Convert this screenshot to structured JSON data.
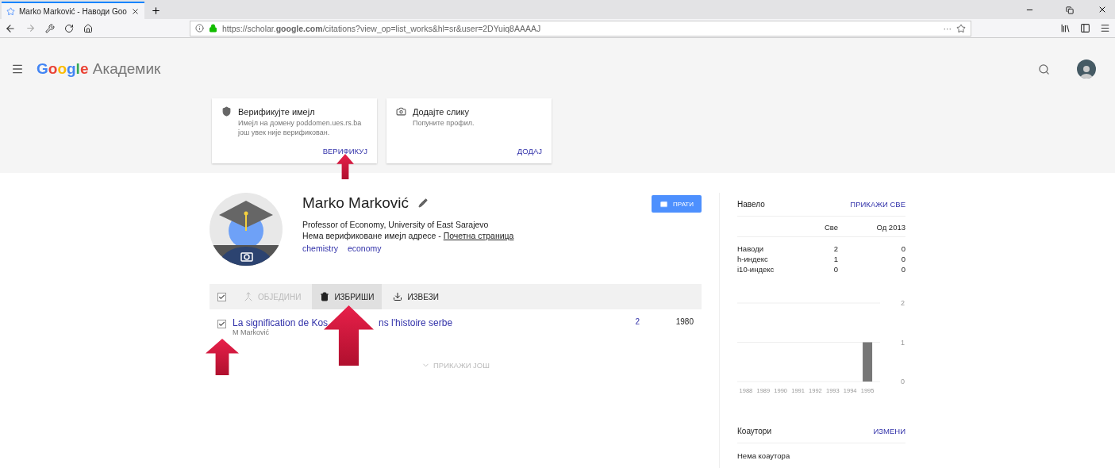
{
  "browser": {
    "tab_title": "Marko Marković - Наводи Goo",
    "url": "https://scholar.**google.com**/citations?view_op=list_works&hl=sr&user=2DYuiq8AAAAJ",
    "url_menu": "···"
  },
  "header": {
    "logo": [
      {
        "letter": "G",
        "color": "#4285f4"
      },
      {
        "letter": "o",
        "color": "#ea4335"
      },
      {
        "letter": "o",
        "color": "#fbbc05"
      },
      {
        "letter": "g",
        "color": "#4285f4"
      },
      {
        "letter": "l",
        "color": "#34a853"
      },
      {
        "letter": "e",
        "color": "#ea4335"
      }
    ],
    "product": "Академик"
  },
  "cards": [
    {
      "kind": "verify",
      "title": "Верификујте имејл",
      "text": "Имејл на домену poddomen.ues.rs.ba још увек није верификован.",
      "action": "ВЕРИФИКУЈ"
    },
    {
      "kind": "photo",
      "title": "Додајте слику",
      "text": "Попуните профил.",
      "action": "ДОДАЈ"
    }
  ],
  "profile": {
    "name": "Marko Marković",
    "affiliation": "Professor of Economy, University of East Sarajevo",
    "email_note": "Нема верификоване имејл адресе - ",
    "homepage": "Почетна страница",
    "interests": [
      "chemistry",
      "economy"
    ],
    "follow": "ПРАТИ"
  },
  "toolbar": {
    "select_all": true,
    "actions": [
      {
        "kind": "merge",
        "label": "ОБЈЕДИНИ",
        "disabled": true,
        "selected": false
      },
      {
        "kind": "delete",
        "label": "ИЗБРИШИ",
        "disabled": false,
        "selected": true
      },
      {
        "kind": "export",
        "label": "ИЗВЕЗИ",
        "disabled": false,
        "selected": false
      }
    ]
  },
  "articles": [
    {
      "title_start": "La signification de Kos",
      "title_end": "ns l'histoire serbe",
      "authors": "M Marković",
      "cited_by": "2",
      "year": "1980",
      "checked": true
    }
  ],
  "show_more": "ПРИКАЖИ ЈОШ",
  "citations": {
    "title": "Навело",
    "view_all": "ПРИКАЖИ СВЕ",
    "columns": [
      "Све",
      "Од 2013"
    ],
    "rows": [
      {
        "label": "Наводи",
        "all": "2",
        "since": "0"
      },
      {
        "label": "h-индекс",
        "all": "1",
        "since": "0"
      },
      {
        "label": "i10-индекс",
        "all": "0",
        "since": "0"
      }
    ],
    "chart_data": {
      "type": "bar",
      "categories": [
        "1988",
        "1989",
        "1990",
        "1991",
        "1992",
        "1993",
        "1994",
        "1995"
      ],
      "values": [
        0,
        0,
        0,
        0,
        0,
        0,
        0,
        1
      ],
      "ylim": [
        0,
        2
      ],
      "yticks": [
        0,
        1,
        2
      ]
    }
  },
  "coauthors": {
    "title": "Коаутори",
    "edit": "ИЗМЕНИ",
    "empty": "Нема коаутора"
  }
}
